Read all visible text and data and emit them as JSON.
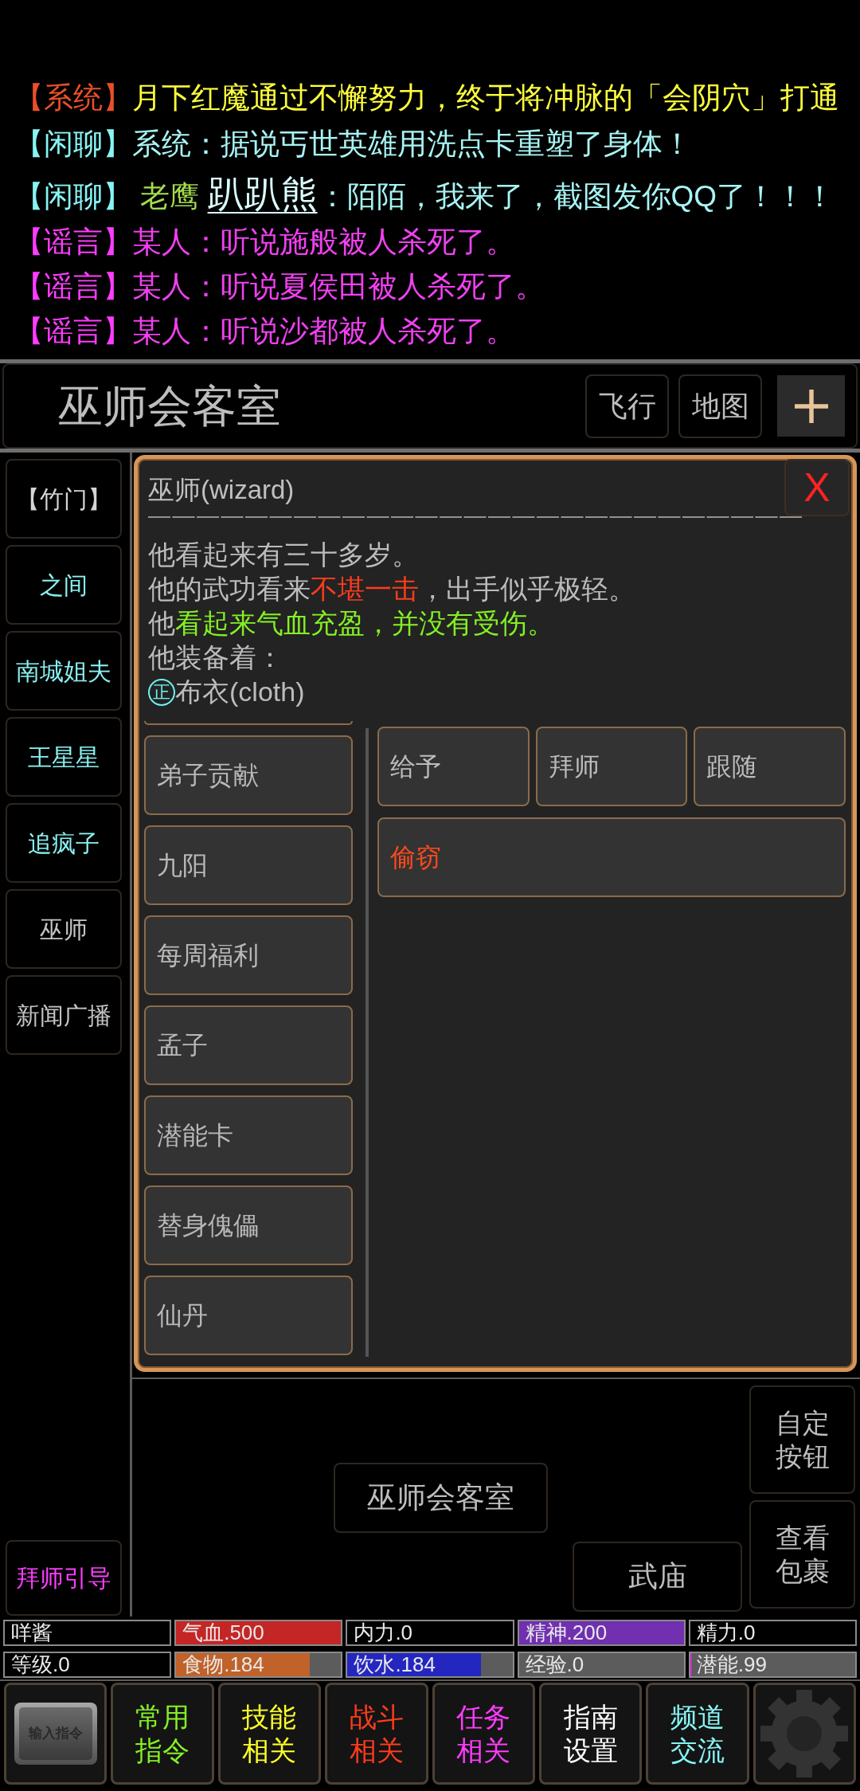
{
  "chat": [
    {
      "parts": [
        {
          "text": "【系统】",
          "color": "#e84f2a"
        },
        {
          "text": "月下红魔通过不懈努力，终于将冲脉的「会阴穴」打通",
          "color": "#ffff3c"
        }
      ]
    },
    {
      "parts": [
        {
          "text": "【闲聊】",
          "color": "#88f4f4"
        },
        {
          "text": "系统：据说丐世英雄用洗点卡重塑了身体！",
          "color": "#a8f4f4"
        }
      ]
    },
    {
      "parts": [
        {
          "text": "【闲聊】",
          "color": "#88f4f4"
        },
        {
          "text": " 老鹰 ",
          "color": "#a4dc4c"
        },
        {
          "text": "趴趴熊",
          "color": "#dcffff",
          "kind": "link"
        },
        {
          "text": "：陌陌，我来了，截图发你QQ了！！！",
          "color": "#a8f4f4"
        }
      ]
    },
    {
      "parts": [
        {
          "text": "【谣言】",
          "color": "#ff3cff"
        },
        {
          "text": "某人：听说施般被人杀死了。",
          "color": "#f040f0"
        }
      ]
    },
    {
      "parts": [
        {
          "text": "【谣言】",
          "color": "#ff3cff"
        },
        {
          "text": "某人：听说夏侯田被人杀死了。",
          "color": "#f040f0"
        }
      ]
    },
    {
      "parts": [
        {
          "text": "【谣言】",
          "color": "#ff3cff"
        },
        {
          "text": "某人：听说沙都被人杀死了。",
          "color": "#f040f0"
        }
      ]
    }
  ],
  "header": {
    "title": "巫师会客室",
    "buttons": [
      "飞行",
      "地图"
    ]
  },
  "sidebar": {
    "items": [
      {
        "label": "【竹门】",
        "color": "#d4d4d4"
      },
      {
        "label": "之间",
        "color": "#8af0f0"
      },
      {
        "label": "南城姐夫",
        "color": "#8af0f0"
      },
      {
        "label": "王星星",
        "color": "#8af0f0"
      },
      {
        "label": "追疯子",
        "color": "#8af0f0"
      },
      {
        "label": "巫师",
        "color": "#c4c4c4"
      },
      {
        "label": "新闻广播",
        "color": "#c4c4c4"
      }
    ],
    "footer": [
      {
        "label": "拜师引导",
        "color": "#ff3cff"
      }
    ]
  },
  "npc_panel": {
    "title": "巫师(wizard)",
    "close": "X",
    "rule": "———————————————————————————",
    "description": [
      {
        "parts": [
          {
            "text": "他看起来有三十多岁。",
            "color": "#bcbcbc"
          }
        ]
      },
      {
        "parts": [
          {
            "text": "他的武功看来",
            "color": "#bcbcbc"
          },
          {
            "text": "不堪一击",
            "color": "#ff3c1c"
          },
          {
            "text": "，出手似乎极轻。",
            "color": "#bcbcbc"
          }
        ]
      },
      {
        "parts": [
          {
            "text": "他",
            "color": "#bcbcbc"
          },
          {
            "text": "看起来气血充盈，并没有受伤。",
            "color": "#84f024"
          }
        ]
      },
      {
        "parts": [
          {
            "text": "他装备着：",
            "color": "#bcbcbc"
          }
        ]
      }
    ],
    "equipment": [
      {
        "badge": "正",
        "text": "布衣(cloth)"
      }
    ],
    "options": [
      "弟子贡献",
      "九阳",
      "每周福利",
      "孟子",
      "潜能卡",
      "替身傀儡",
      "仙丹"
    ],
    "action_rows": [
      {
        "items": [
          {
            "label": "给予",
            "color": "#bcbcbc"
          },
          {
            "label": "拜师",
            "color": "#bcbcbc"
          },
          {
            "label": "跟随",
            "color": "#bcbcbc"
          }
        ]
      },
      {
        "items": [
          {
            "label": "偷窃",
            "color": "#ff4a1c"
          }
        ]
      }
    ]
  },
  "map": {
    "rooms": [
      {
        "label": "巫师会客室"
      },
      {
        "label": "武庙"
      }
    ]
  },
  "side_buttons": [
    {
      "lines": [
        "自定",
        "按钮"
      ]
    },
    {
      "lines": [
        "查看",
        "包裹"
      ]
    }
  ],
  "stats": [
    {
      "kind": "plain",
      "label": "咩酱"
    },
    {
      "kind": "bar",
      "label": "气血.500",
      "level": 1,
      "color": "#c42626"
    },
    {
      "kind": "plain",
      "label": "内力.0"
    },
    {
      "kind": "bar",
      "label": "精神.200",
      "level": 1,
      "color": "#7030b0"
    },
    {
      "kind": "plain",
      "label": "精力.0"
    },
    {
      "kind": "plain",
      "label": "等级.0"
    },
    {
      "kind": "bar",
      "label": "食物.184",
      "level": 0.81,
      "color": "#c0622a"
    },
    {
      "kind": "bar",
      "label": "饮水.184",
      "level": 0.81,
      "color": "#2426c0"
    },
    {
      "kind": "bar",
      "label": "经验.0"
    },
    {
      "kind": "bar",
      "label": "潜能.99",
      "level": 0.01,
      "color": "#c030c0"
    }
  ],
  "nav": [
    {
      "kind": "image",
      "label": "输入指令"
    },
    {
      "kind": "text",
      "lines": [
        "常用",
        "指令"
      ],
      "color": "#84f024"
    },
    {
      "kind": "text",
      "lines": [
        "技能",
        "相关"
      ],
      "color": "#ffff28"
    },
    {
      "kind": "text",
      "lines": [
        "战斗",
        "相关"
      ],
      "color": "#ff3c1c"
    },
    {
      "kind": "text",
      "lines": [
        "任务",
        "相关"
      ],
      "color": "#ff3cff"
    },
    {
      "kind": "text",
      "lines": [
        "指南",
        "设置"
      ],
      "color": "#ffffff"
    },
    {
      "kind": "text",
      "lines": [
        "频道",
        "交流"
      ],
      "color": "#88f4f4"
    },
    {
      "kind": "gear"
    }
  ]
}
